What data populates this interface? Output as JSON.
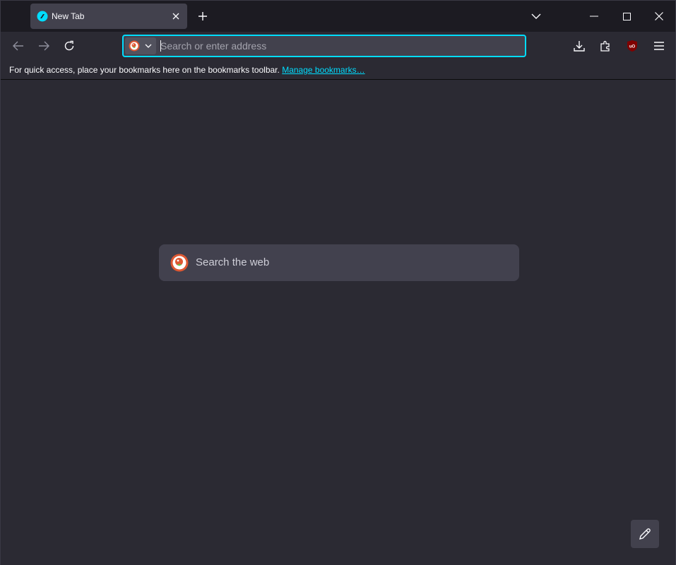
{
  "tabs": [
    {
      "title": "New Tab",
      "favicon": "firefox-newtab-icon",
      "active": true
    }
  ],
  "window_controls": {
    "minimize": "minimize-icon",
    "maximize": "maximize-icon",
    "close": "close-icon"
  },
  "urlbar": {
    "placeholder": "Search or enter address",
    "value": "",
    "engine": "duckduckgo-icon"
  },
  "toolbar_icons": [
    "back-icon",
    "forward-icon",
    "reload-icon",
    "downloads-icon",
    "extensions-icon",
    "ublock-icon",
    "menu-icon"
  ],
  "bookmarks_bar": {
    "message": "For quick access, place your bookmarks here on the bookmarks toolbar.",
    "link": "Manage bookmarks…"
  },
  "newtab": {
    "search_placeholder": "Search the web"
  },
  "colors": {
    "accent": "#00ddff",
    "background": "#2b2a33",
    "tabstrip": "#1c1b22",
    "field": "#42414d"
  }
}
